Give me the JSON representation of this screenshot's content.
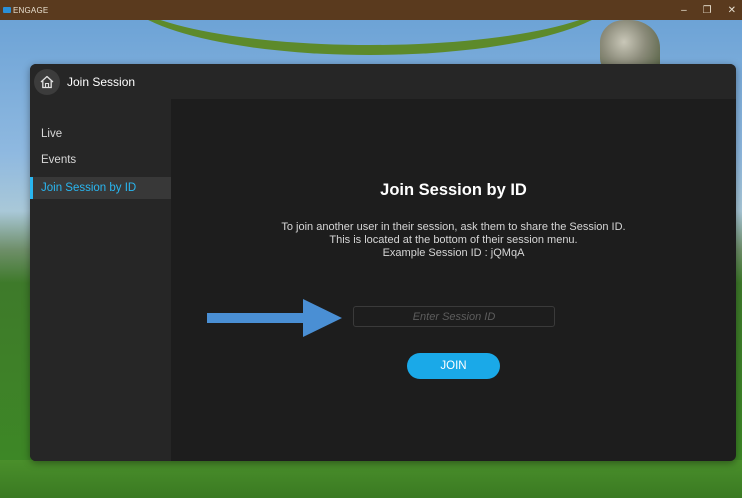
{
  "window": {
    "app_title": "ENGAGE",
    "minimize_glyph": "–",
    "maximize_glyph": "❐",
    "close_glyph": "✕"
  },
  "dialog": {
    "title": "Join Session",
    "home_icon": "home-icon"
  },
  "sidebar": {
    "items": [
      {
        "label": "Live",
        "active": false
      },
      {
        "label": "Events",
        "active": false
      },
      {
        "label": "Join Session by ID",
        "active": true
      }
    ]
  },
  "main": {
    "heading": "Join Session by ID",
    "description": "To join another user in their session, ask them to share the Session ID. This is located at the bottom of their session menu.",
    "example": "Example Session ID : jQMqA",
    "session_input": {
      "value": "",
      "placeholder": "Enter Session ID"
    },
    "join_label": "JOIN"
  },
  "colors": {
    "accent": "#29b6f0",
    "join_button": "#1aa9e8",
    "dialog_bg": "#1d1d1d",
    "sidebar_bg": "#262626",
    "annotation_arrow": "#4a8fd4"
  }
}
